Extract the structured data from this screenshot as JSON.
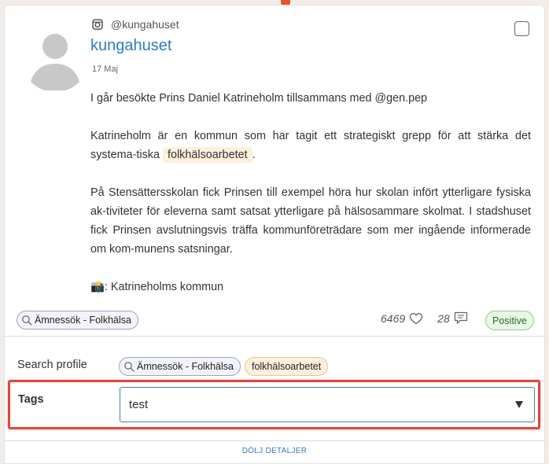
{
  "post": {
    "platform_icon": "instagram-icon",
    "handle": "@kungahuset",
    "author": "kungahuset",
    "date": "17 Maj",
    "para1": "I går besökte Prins Daniel Katrineholm tillsammans med @gen.pep",
    "para2_before": "Katrineholm är en kommun som har tagit ett strategiskt grepp för att stärka det systema-tiska ",
    "para2_highlight": "folkhälsoarbetet",
    "para2_after": ".",
    "para3": "På Stensättersskolan fick Prinsen till exempel höra hur skolan infört ytterligare fysiska ak-tiviteter för eleverna samt satsat ytterligare på hälsosammare skolmat. I stadshuset fick Prinsen avslutningsvis träffa kommunföreträdare som mer ingående informerade om kom-munens satsningar.",
    "photo_emoji": "📸",
    "photo_credit": ": Katrineholms kommun"
  },
  "search_chip": "Ämnessök - Folkhälsa",
  "stats": {
    "likes": "6469",
    "comments": "28",
    "sentiment": "Positive"
  },
  "colors": {
    "link": "#2f7bbf",
    "positive_bg": "#e9f7e6",
    "highlight_bg": "#fdf0dd",
    "annotation_red": "#e0463c"
  },
  "details": {
    "search_profile_label": "Search profile",
    "search_profile_chips": [
      "Ämnessök - Folkhälsa"
    ],
    "keyword_chip": "folkhälsoarbetet",
    "tags_label": "Tags",
    "tags_value": "test"
  },
  "footer": {
    "toggle_label": "DÖLJ DETALJER"
  }
}
